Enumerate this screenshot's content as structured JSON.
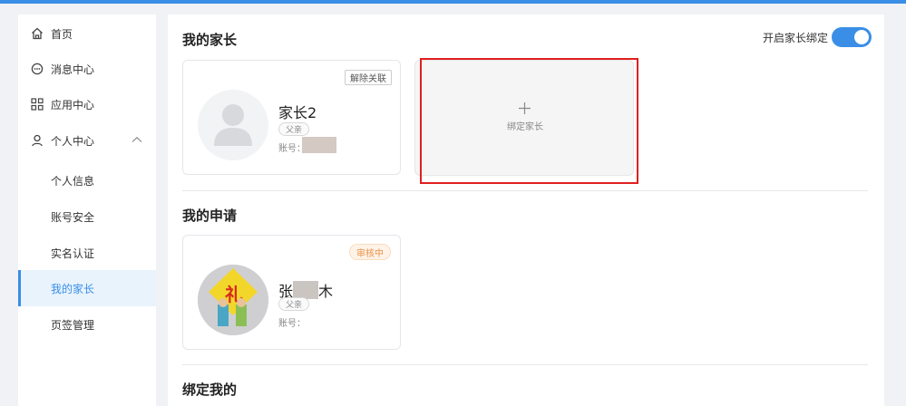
{
  "sidebar": {
    "items": [
      {
        "label": "首页",
        "icon": "home-icon"
      },
      {
        "label": "消息中心",
        "icon": "message-icon"
      },
      {
        "label": "应用中心",
        "icon": "apps-grid-icon"
      },
      {
        "label": "个人中心",
        "icon": "user-icon"
      }
    ],
    "sub_items": [
      {
        "label": "个人信息"
      },
      {
        "label": "账号安全"
      },
      {
        "label": "实名认证"
      },
      {
        "label": "我的家长",
        "active": true
      },
      {
        "label": "页签管理"
      }
    ]
  },
  "main": {
    "my_parents": {
      "title": "我的家长",
      "toggle_label": "开启家长绑定",
      "toggle_on": true,
      "card": {
        "name": "家长2",
        "relation": "父亲",
        "account_label": "账号：",
        "unbind_label": "解除关联"
      },
      "add_label": "绑定家长"
    },
    "my_applications": {
      "title": "我的申请",
      "card": {
        "name": "张",
        "name_tail": "木",
        "relation": "父亲",
        "account_label": "账号：",
        "status": "审核中"
      }
    },
    "bound_me": {
      "title": "绑定我的"
    }
  },
  "colors": {
    "accent": "#3a8ee6",
    "highlight": "#e01f1f",
    "pending": "#e8934a"
  }
}
